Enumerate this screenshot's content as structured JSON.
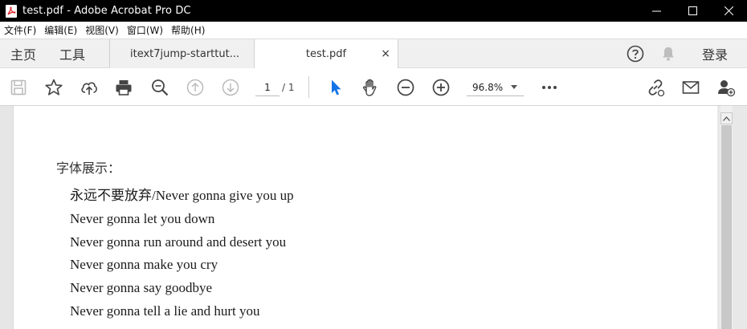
{
  "window": {
    "title": "test.pdf - Adobe Acrobat Pro DC"
  },
  "menu": {
    "items": [
      "文件(F)",
      "编辑(E)",
      "视图(V)",
      "窗口(W)",
      "帮助(H)"
    ]
  },
  "tabs": {
    "home": "主页",
    "tools": "工具",
    "documents": [
      {
        "label": "itext7jump-starttut...",
        "active": false
      },
      {
        "label": "test.pdf",
        "active": true,
        "close": "×"
      }
    ],
    "login": "登录"
  },
  "toolbar": {
    "page_current": "1",
    "page_total": "/ 1",
    "zoom": "96.8%",
    "icons": [
      "save-icon",
      "star-icon",
      "cloud-upload-icon",
      "print-icon",
      "zoom-search-icon",
      "page-up-icon",
      "page-down-icon",
      "select-arrow-icon",
      "hand-icon",
      "zoom-out-icon",
      "zoom-in-icon",
      "more-icon",
      "link-icon",
      "mail-icon",
      "add-user-icon"
    ]
  },
  "document": {
    "heading": "字体展示：",
    "lines": [
      "永远不要放弃/Never gonna give you up",
      "Never gonna let you down",
      "Never gonna run around and desert you",
      "Never gonna make you cry",
      "Never gonna say goodbye",
      "Never gonna tell a lie and hurt you"
    ]
  },
  "colors": {
    "titlebar": "#000000",
    "accent_select": "#1473e6",
    "acrobat_red": "#e0242a"
  }
}
